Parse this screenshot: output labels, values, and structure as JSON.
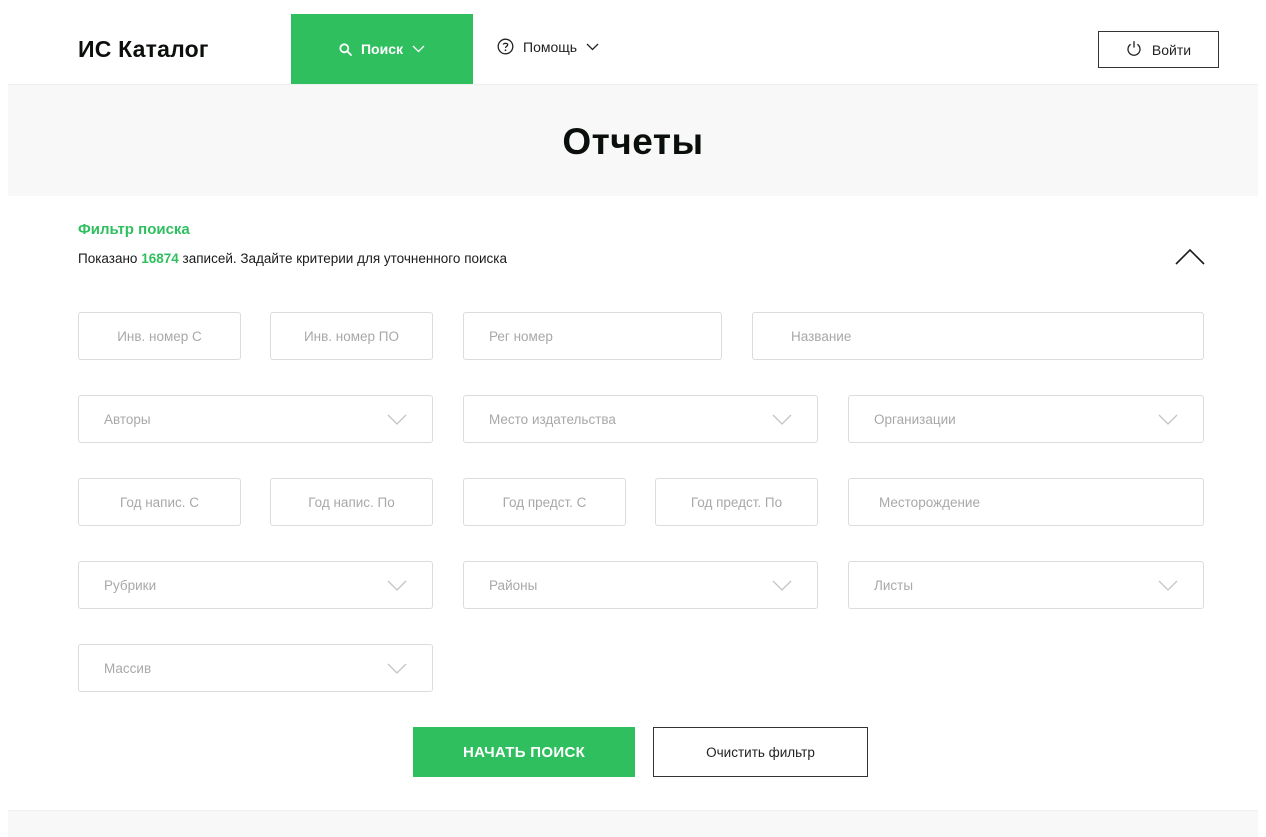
{
  "header": {
    "logo": "ИС Каталог",
    "nav_search_label": "Поиск",
    "nav_help_label": "Помощь",
    "login_label": "Войти"
  },
  "page": {
    "title": "Отчеты"
  },
  "filter": {
    "title": "Фильтр поиска",
    "info_prefix": "Показано",
    "count": "16874",
    "info_suffix": "записей. Задайте критерии для уточненного поиска",
    "fields": {
      "inv_from": "Инв. номер С",
      "inv_to": "Инв. номер ПО",
      "reg_number": "Рег номер",
      "name": "Название",
      "authors": "Авторы",
      "publish_place": "Место издательства",
      "organizations": "Организации",
      "year_written_from": "Год напис. С",
      "year_written_to": "Год напис. По",
      "year_submitted_from": "Год предст. С",
      "year_submitted_to": "Год предст. По",
      "deposit": "Месторождение",
      "rubrics": "Рубрики",
      "districts": "Районы",
      "sheets": "Листы",
      "massif": "Массив"
    },
    "start_button": "НАЧАТЬ ПОИСК",
    "clear_button": "Очистить фильтр"
  },
  "colors": {
    "accent": "#2fbf5f",
    "band": "#f9f8f9",
    "border": "#dcdcdc"
  },
  "icons": {
    "search": "search-icon",
    "help": "help-circle-icon",
    "power": "power-icon",
    "chevron": "chevron-down-icon",
    "collapse": "chevron-up-icon"
  }
}
